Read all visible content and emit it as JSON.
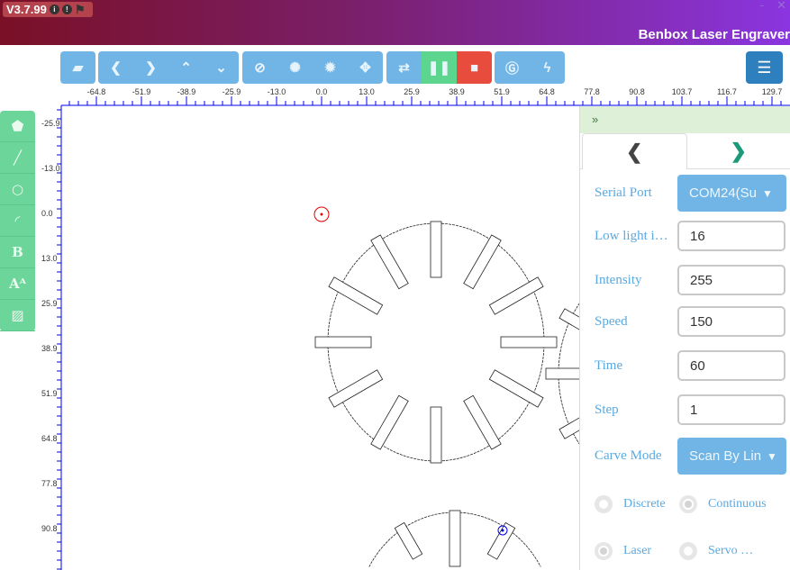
{
  "header": {
    "version": "V3.7.99",
    "title": "Benbox Laser Engraver",
    "minimize": "-",
    "close": "✕"
  },
  "toolbar": {
    "groups": [
      [
        {
          "icon": "folder-open-icon",
          "glyph": "▰"
        }
      ],
      [
        {
          "icon": "chevron-left-icon",
          "glyph": "❮"
        },
        {
          "icon": "chevron-right-icon",
          "glyph": "❯"
        },
        {
          "icon": "chevron-up-icon",
          "glyph": "⌃"
        },
        {
          "icon": "chevron-down-icon",
          "glyph": "⌄"
        }
      ],
      [
        {
          "icon": "ban-icon",
          "glyph": "⊘"
        },
        {
          "icon": "small-sun-icon",
          "glyph": "✺"
        },
        {
          "icon": "large-sun-icon",
          "glyph": "✹"
        },
        {
          "icon": "crosshair-icon",
          "glyph": "✥"
        }
      ],
      [
        {
          "icon": "repeat-icon",
          "glyph": "⇄"
        },
        {
          "icon": "pause-icon",
          "glyph": "❚❚",
          "color": "#5cd68e"
        },
        {
          "icon": "stop-icon",
          "glyph": "■",
          "color": "#e74c3c"
        }
      ],
      [
        {
          "icon": "gcode-icon",
          "glyph": "Ⓖ"
        },
        {
          "icon": "bolt-icon",
          "glyph": "ϟ"
        }
      ]
    ],
    "menu_icon": "menu-icon"
  },
  "ruler": {
    "x_labels": [
      "-64.8",
      "-51.9",
      "-38.9",
      "-25.9",
      "-13.0",
      "0.0",
      "13.0",
      "25.9",
      "38.9",
      "51.9",
      "64.8",
      "77.8",
      "90.8",
      "103.7",
      "116.7",
      "129.7"
    ],
    "y_labels": [
      "-25.9",
      "-13.0",
      "0.0",
      "13.0",
      "25.9",
      "38.9",
      "51.9",
      "64.8",
      "77.8",
      "90.8"
    ]
  },
  "tools": [
    {
      "icon": "tag-icon",
      "glyph": "⬟"
    },
    {
      "icon": "line-icon",
      "glyph": "╱"
    },
    {
      "icon": "circle-icon",
      "glyph": "○"
    },
    {
      "icon": "arc-icon",
      "glyph": "◜"
    },
    {
      "icon": "bold-text-icon",
      "glyph": "B"
    },
    {
      "icon": "font-size-icon",
      "glyph": "Aᴬ"
    },
    {
      "icon": "image-icon",
      "glyph": "▨"
    }
  ],
  "panel": {
    "collapse": "»",
    "tab_prev": "❮",
    "tab_next": "❯",
    "serial_port": {
      "label": "Serial Port",
      "value": "COM24(Su"
    },
    "fields": [
      {
        "label": "Low light i…",
        "value": "16"
      },
      {
        "label": "Intensity",
        "value": "255"
      },
      {
        "label": "Speed",
        "value": "150"
      },
      {
        "label": "Time",
        "value": "60"
      },
      {
        "label": "Step",
        "value": "1"
      }
    ],
    "carve_mode": {
      "label": "Carve Mode",
      "value": "Scan By Lin"
    },
    "radios": [
      {
        "label": "Discrete",
        "checked": false
      },
      {
        "label": "Continuous",
        "checked": true
      },
      {
        "label": "Laser",
        "checked": true
      },
      {
        "label": "Servo …",
        "checked": false
      }
    ]
  },
  "colors": {
    "ruler": "#0000ee",
    "start_marker": "#e00000",
    "end_marker": "#0000ee"
  }
}
